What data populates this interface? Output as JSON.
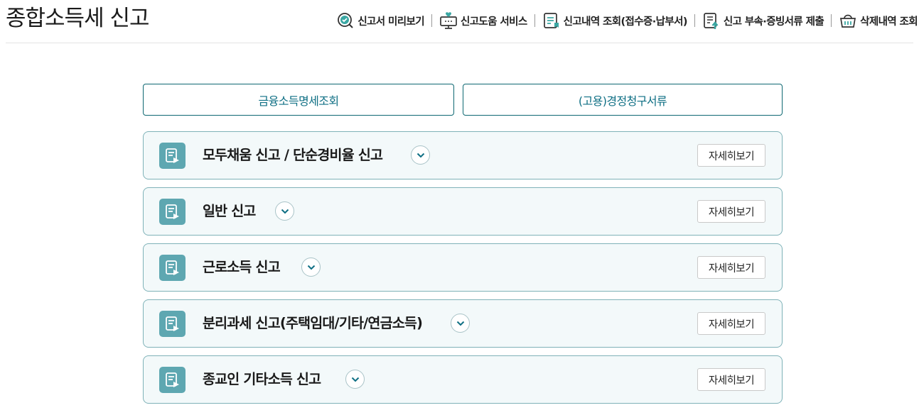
{
  "header": {
    "title": "종합소득세 신고",
    "nav": [
      {
        "label": "신고서 미리보기",
        "icon": "preview-check-icon"
      },
      {
        "label": "신고도움 서비스",
        "icon": "help-monitor-icon"
      },
      {
        "label": "신고내역 조회(접수증·납부서)",
        "icon": "document-list-icon"
      },
      {
        "label": "신고 부속·증빙서류 제출",
        "icon": "document-upload-icon"
      },
      {
        "label": "삭제내역 조회",
        "icon": "basket-icon"
      }
    ]
  },
  "quick_links": [
    {
      "label": "금융소득명세조회"
    },
    {
      "label": "(고용)경정청구서류"
    }
  ],
  "sections": [
    {
      "title": "모두채움 신고 / 단순경비율 신고",
      "detail_label": "자세히보기"
    },
    {
      "title": "일반 신고",
      "detail_label": "자세히보기"
    },
    {
      "title": "근로소득 신고",
      "detail_label": "자세히보기"
    },
    {
      "title": "분리과세 신고(주택임대/기타/연금소득)",
      "detail_label": "자세히보기"
    },
    {
      "title": "종교인 기타소득 신고",
      "detail_label": "자세히보기"
    }
  ],
  "colors": {
    "accent": "#0f6f84",
    "section_bg": "#f3f9fa",
    "icon_bg": "#5ea7b1"
  }
}
